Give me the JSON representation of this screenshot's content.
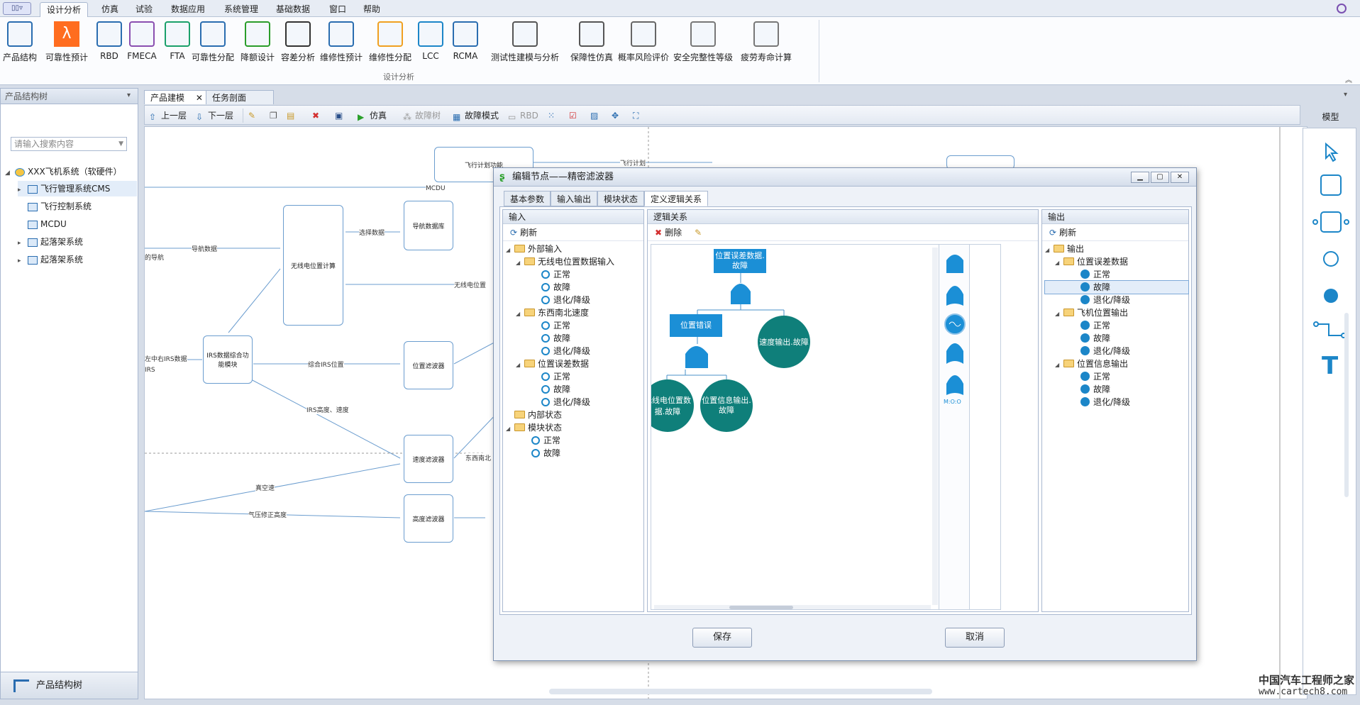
{
  "menu": {
    "app_btn": "▯▯▿",
    "tabs": [
      "设计分析",
      "仿真",
      "试验",
      "数据应用",
      "系统管理",
      "基础数据",
      "窗口",
      "帮助"
    ]
  },
  "ribbon": {
    "buttons": [
      "产品结构",
      "可靠性预计",
      "RBD",
      "FMECA",
      "FTA",
      "可靠性分配",
      "降额设计",
      "容差分析",
      "维修性预计",
      "维修性分配",
      "LCC",
      "RCMA",
      "测试性建模与分析",
      "保障性仿真",
      "概率风险评价",
      "安全完整性等级",
      "疲劳寿命计算"
    ],
    "group_label": "设计分析",
    "lambda": "λ"
  },
  "left_panel": {
    "title": "产品结构树",
    "search_placeholder": "请输入搜索内容",
    "tree": [
      "XXX飞机系统（软硬件）",
      "飞行管理系统CMS",
      "飞行控制系统",
      "MCDU",
      "起落架系统",
      "起落架系统"
    ],
    "footer": "产品结构树"
  },
  "doc_tabs": [
    "产品建模",
    "任务剖面"
  ],
  "toolbar": [
    "上一层",
    "下一层",
    "仿真",
    "故障树",
    "故障模式",
    "RBD"
  ],
  "right": {
    "model_label": "模型"
  },
  "canvas": {
    "boxes": [
      "飞行计划功能",
      "导航数据库",
      "无线电位置计算",
      "IRS数据综合功能模块",
      "位置滤波器",
      "速度滤波器",
      "高度滤波器"
    ],
    "labels": [
      "飞行计划",
      "MCDU",
      "选择数据",
      "导航数据",
      "无线电位置",
      "综合IRS位置",
      "IRS高度、速度",
      "东西南北",
      "真空速",
      "气压修正高度",
      "左中右IRS数据",
      "IRS",
      "的导航"
    ]
  },
  "dialog": {
    "title": "编辑节点——精密滤波器",
    "tabs": [
      "基本参数",
      "输入输出",
      "模块状态",
      "定义逻辑关系"
    ],
    "input": {
      "header": "输入",
      "refresh": "刷新",
      "tree": {
        "root": "外部输入",
        "groups": [
          {
            "name": "无线电位置数据输入",
            "states": [
              "正常",
              "故障",
              "退化/降级"
            ]
          },
          {
            "name": "东西南北速度",
            "states": [
              "正常",
              "故障",
              "退化/降级"
            ]
          },
          {
            "name": "位置误差数据",
            "states": [
              "正常",
              "故障",
              "退化/降级"
            ]
          }
        ],
        "internal": "内部状态",
        "module": "模块状态",
        "module_states": [
          "正常",
          "故障"
        ]
      }
    },
    "logic": {
      "header": "逻辑关系",
      "delete": "删除",
      "top_event": "位置误差数据.故障",
      "mid_event": "位置错误",
      "leaf1": "速度输出.故障",
      "leaf2": "无线电位置数据.故障",
      "leaf3": "位置信息输出.故障",
      "mofn": "M:O:O"
    },
    "output": {
      "header": "输出",
      "refresh": "刷新",
      "root": "输出",
      "groups": [
        {
          "name": "位置误差数据",
          "states": [
            "正常",
            "故障",
            "退化/降级"
          ]
        },
        {
          "name": "飞机位置输出",
          "states": [
            "正常",
            "故障",
            "退化/降级"
          ]
        },
        {
          "name": "位置信息输出",
          "states": [
            "正常",
            "故障",
            "退化/降级"
          ]
        }
      ]
    },
    "save": "保存",
    "cancel": "取消"
  },
  "watermark": {
    "cn": "中国汽车工程师之家",
    "url": "www.cartech8.com"
  },
  "colors": {
    "accent": "#1c86c8",
    "teal": "#0f7f7a",
    "node_blue": "#1b8fd6"
  }
}
